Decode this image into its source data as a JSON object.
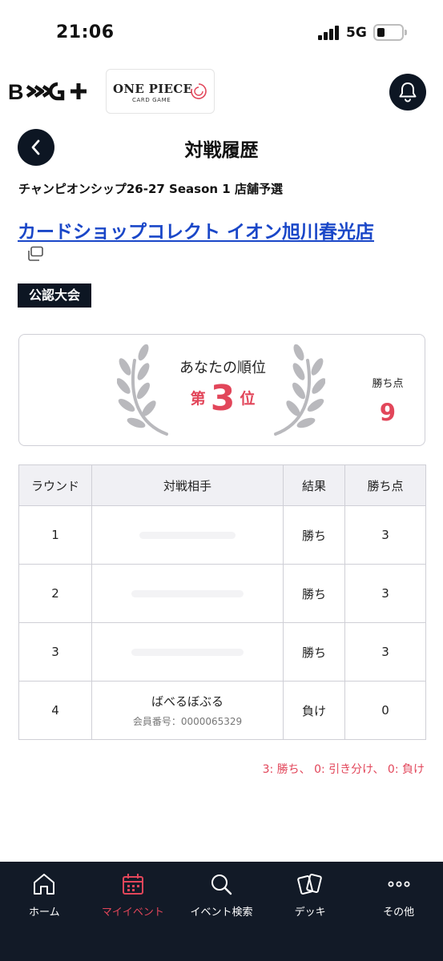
{
  "status_bar": {
    "time": "21:06",
    "network": "5G",
    "battery_level": 0.2
  },
  "header": {
    "brand_logo_icon": "bushiroad-bcg-plus-logo",
    "game_logo": {
      "title": "ONE PIECE",
      "subtitle": "CARD GAME"
    },
    "notification_icon": "bell-icon"
  },
  "page": {
    "title": "対戦履歴",
    "back_icon": "chevron-left-icon"
  },
  "event": {
    "name": "チャンピオンシップ26-27 Season 1 店舗予選",
    "shop_name": "カードショップコレクト イオン旭川春光店",
    "external_icon": "copy-window-icon",
    "category": "公認大会"
  },
  "rank_card": {
    "label": "あなたの順位",
    "rank_prefix": "第",
    "rank_number": "3",
    "rank_suffix": "位",
    "points_label": "勝ち点",
    "points_value": "9",
    "accent_color": "#e2465a"
  },
  "results": {
    "headers": [
      "ラウンド",
      "対戦相手",
      "結果",
      "勝ち点"
    ],
    "rows": [
      {
        "round": "1",
        "opponent_name": "",
        "opponent_id": "",
        "result": "勝ち",
        "points": "3"
      },
      {
        "round": "2",
        "opponent_name": "",
        "opponent_id": "",
        "result": "勝ち",
        "points": "3"
      },
      {
        "round": "3",
        "opponent_name": "",
        "opponent_id": "",
        "result": "勝ち",
        "points": "3"
      },
      {
        "round": "4",
        "opponent_name": "ばべるぼぶる",
        "opponent_id": "会員番号：0000065329",
        "result": "負け",
        "points": "0"
      }
    ]
  },
  "legend": "3: 勝ち、 0: 引き分け、 0: 負け",
  "bottom_nav": {
    "items": [
      {
        "label": "ホーム",
        "icon": "home-icon",
        "active": false
      },
      {
        "label": "マイイベント",
        "icon": "calendar-icon",
        "active": true
      },
      {
        "label": "イベント検索",
        "icon": "search-icon",
        "active": false
      },
      {
        "label": "デッキ",
        "icon": "cards-icon",
        "active": false
      },
      {
        "label": "その他",
        "icon": "more-icon",
        "active": false
      }
    ],
    "background": "#121a27",
    "active_color": "#e2465a"
  }
}
